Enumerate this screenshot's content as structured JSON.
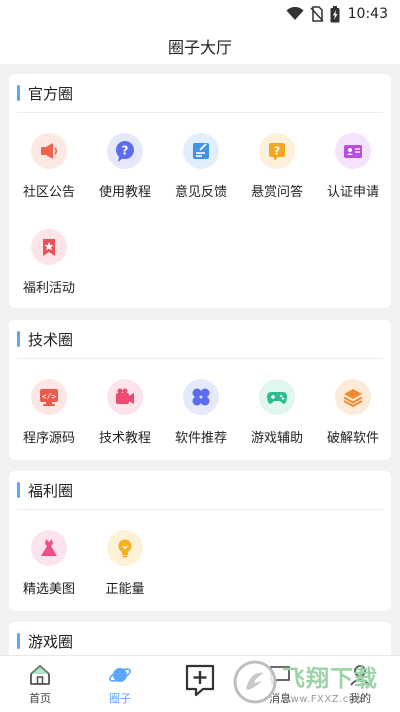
{
  "status": {
    "time": "10:43"
  },
  "header": {
    "title": "圈子大厅"
  },
  "sections": [
    {
      "title": "官方圈",
      "items": [
        {
          "label": "社区公告",
          "icon": "megaphone-icon"
        },
        {
          "label": "使用教程",
          "icon": "question-bubble-icon"
        },
        {
          "label": "意见反馈",
          "icon": "feedback-icon"
        },
        {
          "label": "悬赏问答",
          "icon": "bounty-question-icon"
        },
        {
          "label": "认证申请",
          "icon": "id-card-icon"
        },
        {
          "label": "福利活动",
          "icon": "bookmark-star-icon"
        }
      ]
    },
    {
      "title": "技术圈",
      "items": [
        {
          "label": "程序源码",
          "icon": "code-monitor-icon"
        },
        {
          "label": "技术教程",
          "icon": "video-camera-icon"
        },
        {
          "label": "软件推荐",
          "icon": "apps-grid-icon"
        },
        {
          "label": "游戏辅助",
          "icon": "gamepad-icon"
        },
        {
          "label": "破解软件",
          "icon": "layers-icon"
        }
      ]
    },
    {
      "title": "福利圈",
      "items": [
        {
          "label": "精选美图",
          "icon": "dress-icon"
        },
        {
          "label": "正能量",
          "icon": "lightbulb-icon"
        }
      ]
    },
    {
      "title": "游戏圈",
      "items": []
    }
  ],
  "bottom_nav": [
    {
      "label": "首页",
      "icon": "home-icon",
      "active": false
    },
    {
      "label": "圈子",
      "icon": "planet-icon",
      "active": true
    },
    {
      "label": "",
      "icon": "add-post-icon",
      "active": false
    },
    {
      "label": "消息",
      "icon": "message-icon",
      "active": false
    },
    {
      "label": "我的",
      "icon": "profile-icon",
      "active": false
    }
  ],
  "watermark": {
    "brand": "飞翔下载",
    "url": "www.FXXZ.com"
  },
  "colors": {
    "accent_bar": "#5aa7ff",
    "active_nav": "#5aa7ff",
    "inactive_nav": "#444444"
  }
}
